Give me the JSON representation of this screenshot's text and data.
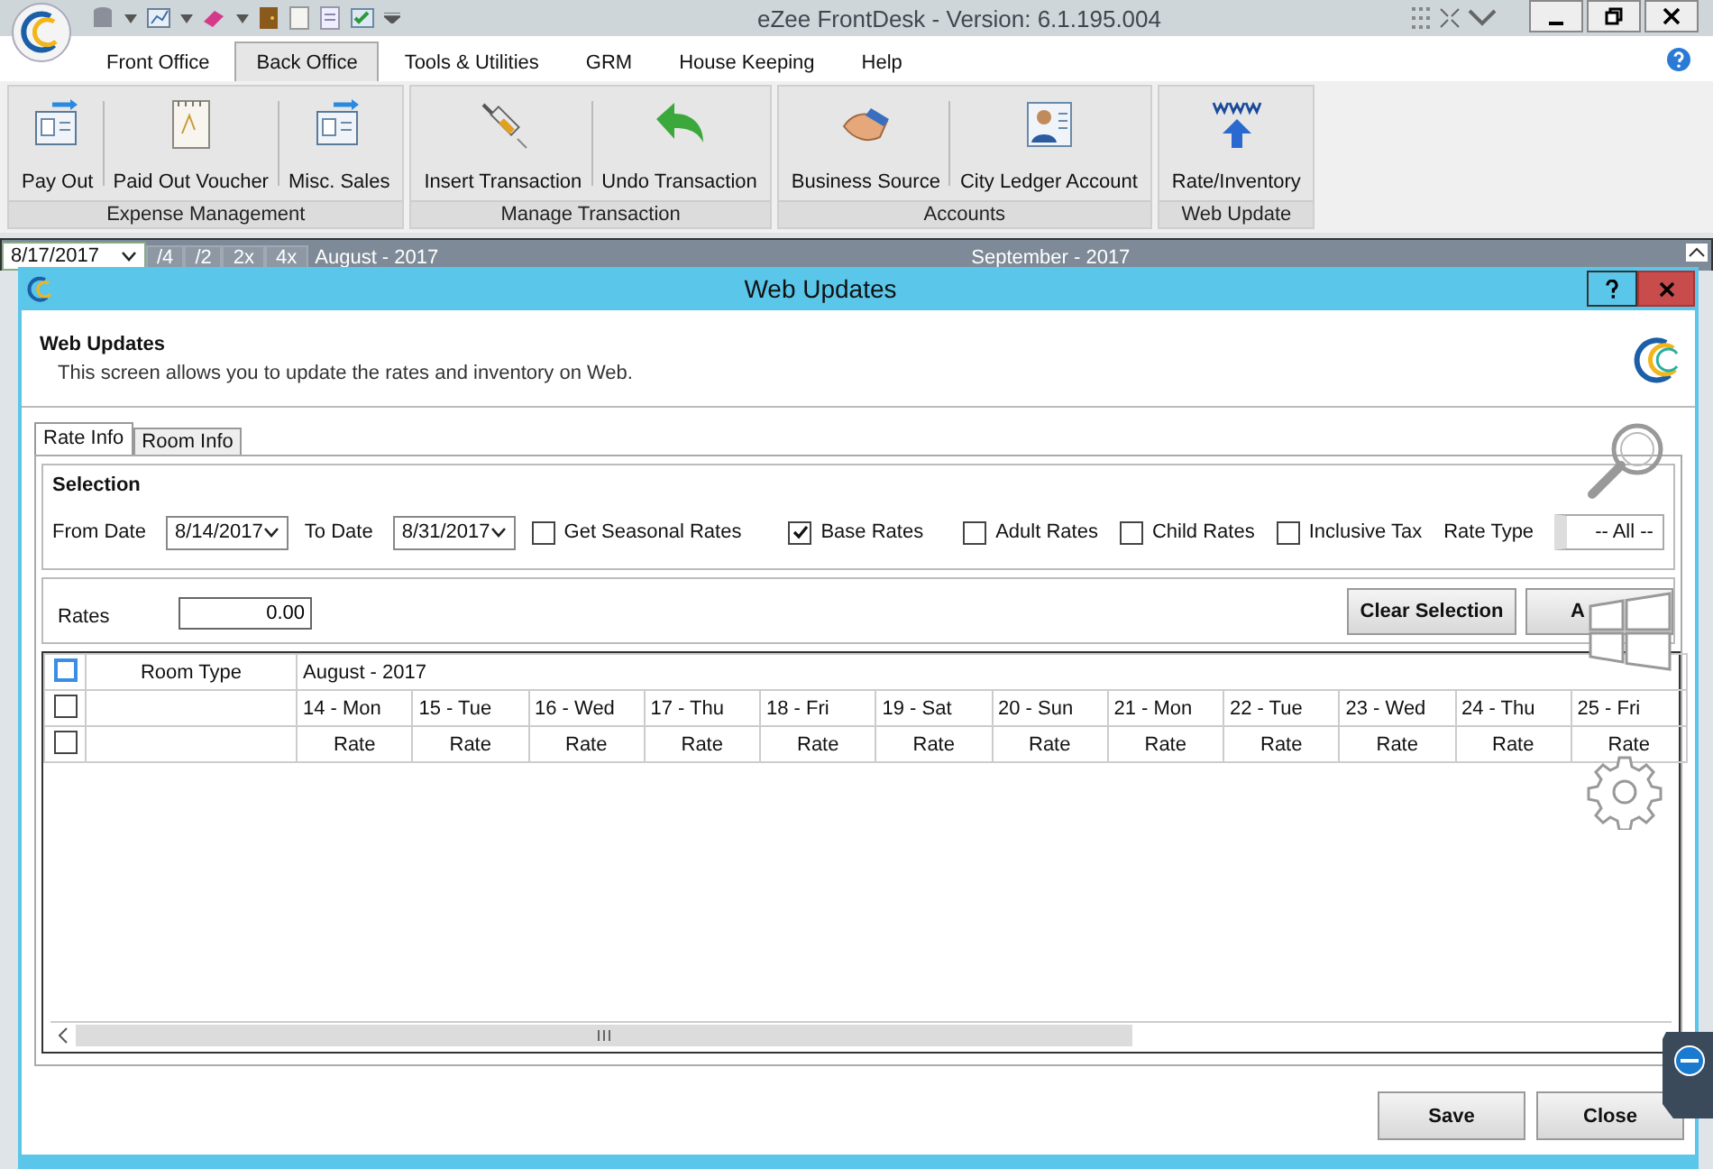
{
  "window": {
    "title": "eZee FrontDesk - Version: 6.1.195.004"
  },
  "menu_tabs": [
    {
      "label": "Front Office",
      "selected": false
    },
    {
      "label": "Back Office",
      "selected": true
    },
    {
      "label": "Tools & Utilities",
      "selected": false
    },
    {
      "label": "GRM",
      "selected": false
    },
    {
      "label": "House Keeping",
      "selected": false
    },
    {
      "label": "Help",
      "selected": false
    }
  ],
  "ribbon": [
    {
      "label": "Expense Management",
      "buttons": [
        "Pay Out",
        "Paid Out Voucher",
        "Misc. Sales"
      ]
    },
    {
      "label": "Manage Transaction",
      "buttons": [
        "Insert Transaction",
        "Undo Transaction"
      ]
    },
    {
      "label": "Accounts",
      "buttons": [
        "Business Source",
        "City Ledger Account"
      ]
    },
    {
      "label": "Web Update",
      "buttons": [
        "Rate/Inventory"
      ]
    }
  ],
  "timeline": {
    "date": "8/17/2017",
    "zoom_buttons": [
      "/4",
      "/2",
      "2x",
      "4x"
    ],
    "months": [
      "August - 2017",
      "September - 2017"
    ]
  },
  "dialog": {
    "title": "Web Updates",
    "heading": "Web Updates",
    "description": "This screen allows you to update the rates and  inventory on Web.",
    "tabs": [
      {
        "label": "Rate Info",
        "selected": true
      },
      {
        "label": "Room Info",
        "selected": false
      }
    ],
    "selection": {
      "title": "Selection",
      "from_label": "From Date",
      "from_value": "8/14/2017",
      "to_label": "To Date",
      "to_value": "8/31/2017",
      "options": [
        {
          "label": "Get Seasonal Rates",
          "checked": false
        },
        {
          "label": "Base Rates",
          "checked": true
        },
        {
          "label": "Adult Rates",
          "checked": false
        },
        {
          "label": "Child Rates",
          "checked": false
        },
        {
          "label": "Inclusive Tax",
          "checked": false
        }
      ],
      "rate_type_label": "Rate Type",
      "rate_type_value": "-- All --"
    },
    "rates": {
      "label": "Rates",
      "value": "0.00",
      "buttons": [
        "Clear Selection",
        "A"
      ]
    },
    "grid": {
      "room_type_header": "Room Type",
      "month": "August - 2017",
      "row_checks": [
        false,
        false,
        false
      ],
      "days": [
        {
          "day": "14 - Mon",
          "sub": "Rate"
        },
        {
          "day": "15 - Tue",
          "sub": "Rate"
        },
        {
          "day": "16 - Wed",
          "sub": "Rate"
        },
        {
          "day": "17 - Thu",
          "sub": "Rate"
        },
        {
          "day": "18 - Fri",
          "sub": "Rate"
        },
        {
          "day": "19 - Sat",
          "sub": "Rate"
        },
        {
          "day": "20 - Sun",
          "sub": "Rate"
        },
        {
          "day": "21 - Mon",
          "sub": "Rate"
        },
        {
          "day": "22 - Tue",
          "sub": "Rate"
        },
        {
          "day": "23 - Wed",
          "sub": "Rate"
        },
        {
          "day": "24 - Thu",
          "sub": "Rate"
        },
        {
          "day": "25 - Fri",
          "sub": "Rate"
        }
      ]
    },
    "buttons": [
      "Save",
      "Close"
    ]
  }
}
